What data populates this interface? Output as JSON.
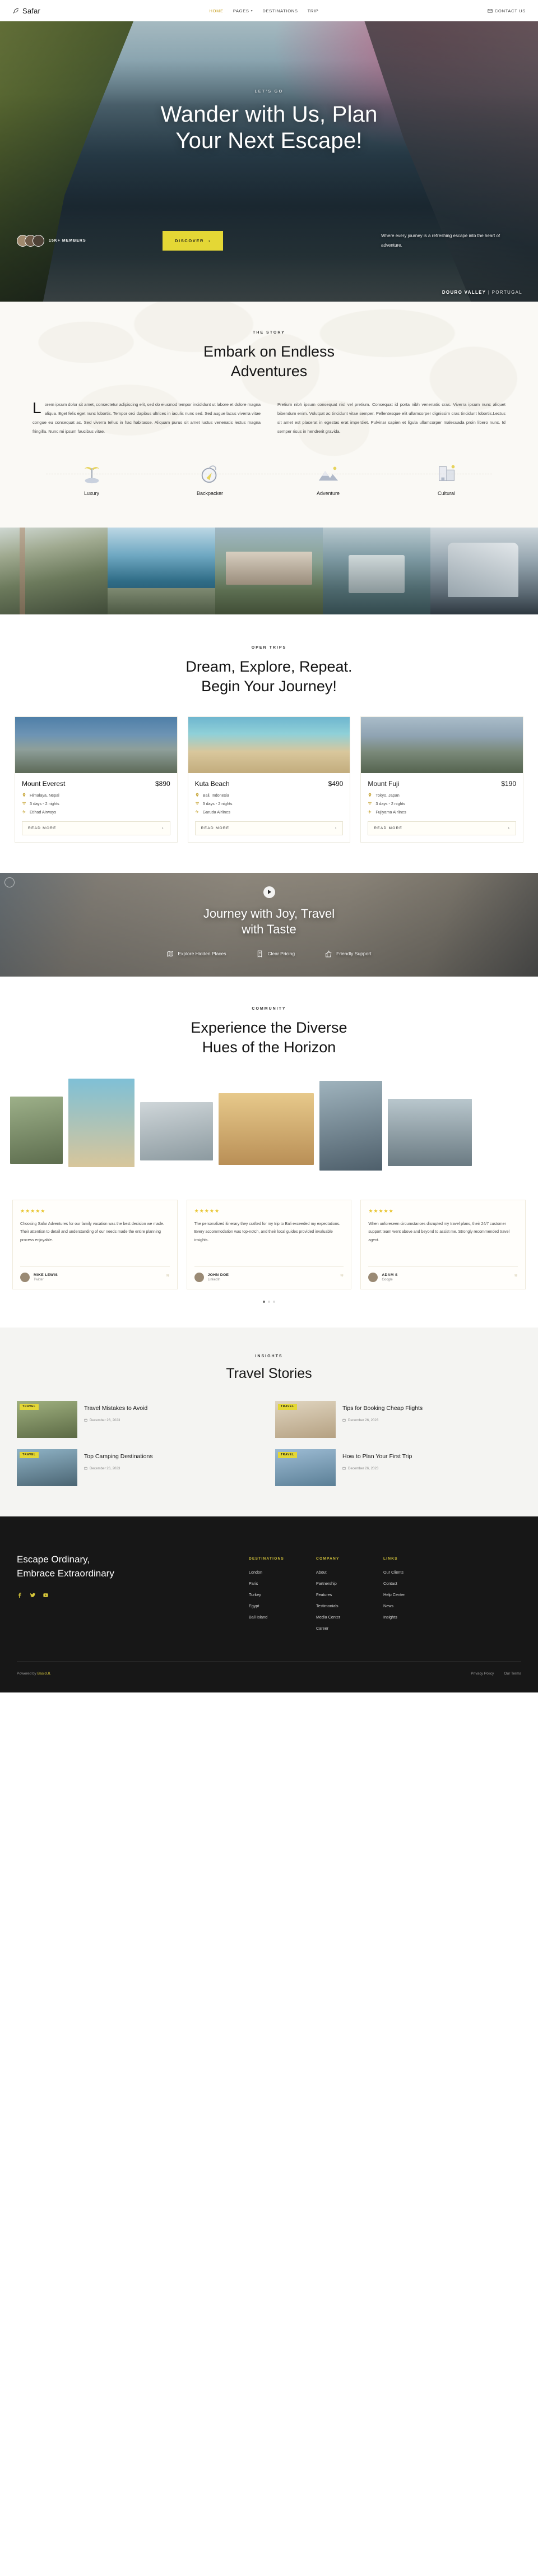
{
  "brand": {
    "name": "Safar",
    "logo_icon": "feather-icon"
  },
  "nav": {
    "links": [
      {
        "label": "HOME",
        "active": true
      },
      {
        "label": "PAGES",
        "has_dropdown": true
      },
      {
        "label": "DESTINATIONS"
      },
      {
        "label": "TRIP"
      }
    ],
    "contact": {
      "label": "CONTACT US",
      "icon": "mail-icon"
    }
  },
  "hero": {
    "eyebrow": "LET'S GO",
    "title_line1": "Wander with Us, Plan",
    "title_line2": "Your Next Escape!",
    "members_count": "15K+ MEMBERS",
    "cta": "DISCOVER",
    "subtitle": "Where every journey is a refreshing escape into the heart of adventure.",
    "location_primary": "DOURO VALLEY",
    "location_separator": "|",
    "location_secondary": "PORTUGAL"
  },
  "story": {
    "eyebrow": "THE STORY",
    "title_line1": "Embark on Endless",
    "title_line2": "Adventures",
    "paragraph_left": "Lorem ipsum dolor sit amet, consectetur adipiscing elit, sed do eiusmod tempor incididunt ut labore et dolore magna aliqua. Eget felis eget nunc lobortis. Tempor orci dapibus ultrices in iaculis nunc sed. Sed augue lacus viverra vitae congue eu consequat ac. Sed viverra tellus in hac habitasse. Aliquam purus sit amet luctus venenatis lectus magna fringilla. Nunc mi ipsum faucibus vitae.",
    "paragraph_right": "Pretium nibh ipsum consequat nisl vel pretium. Consequat id porta nibh venenatis cras. Viverra ipsum nunc aliquet bibendum enim. Volutpat ac tincidunt vitae semper. Pellentesque elit ullamcorper dignissim cras tincidunt lobortis.Lectus sit amet est placerat in egestas erat imperdiet. Pulvinar sapien et ligula ullamcorper malesuada proin libero nunc. Id semper risus in hendrerit gravida.",
    "categories": [
      {
        "label": "Luxury",
        "icon": "palm-tree-icon"
      },
      {
        "label": "Backpacker",
        "icon": "compass-icon"
      },
      {
        "label": "Adventure",
        "icon": "mountain-icon"
      },
      {
        "label": "Cultural",
        "icon": "landmark-icon"
      }
    ]
  },
  "gallery": {
    "items": [
      {
        "alt": "golden-gate-bridge-photo"
      },
      {
        "alt": "coastal-cliff-photo"
      },
      {
        "alt": "lakeside-village-photo"
      },
      {
        "alt": "modern-train-photo"
      },
      {
        "alt": "city-skyline-photo"
      }
    ]
  },
  "trips": {
    "eyebrow": "OPEN TRIPS",
    "title_line1": "Dream, Explore, Repeat.",
    "title_line2": "Begin Your Journey!",
    "cards": [
      {
        "name": "Mount Everest",
        "price": "$890",
        "location": "Himalaya, Nepal",
        "duration": "3 days - 2 nights",
        "airline": "Etihad Airways",
        "cta": "READ MORE"
      },
      {
        "name": "Kuta Beach",
        "price": "$490",
        "location": "Bali, Indonesia",
        "duration": "3 days - 2 nights",
        "airline": "Garuda Airlines",
        "cta": "READ MORE"
      },
      {
        "name": "Mount Fuji",
        "price": "$190",
        "location": "Tokyo, Japan",
        "duration": "3 days - 2 nights",
        "airline": "Fujiyama Airlines",
        "cta": "READ MORE"
      }
    ]
  },
  "video_cta": {
    "title_line1": "Journey with Joy, Travel",
    "title_line2": "with Taste",
    "features": [
      {
        "label": "Explore Hidden Places",
        "icon": "map-icon"
      },
      {
        "label": "Clear Pricing",
        "icon": "receipt-icon"
      },
      {
        "label": "Friendly Support",
        "icon": "thumbs-up-icon"
      }
    ]
  },
  "community": {
    "eyebrow": "COMMUNITY",
    "title_line1": "Experience the Diverse",
    "title_line2": "Hues of the Horizon",
    "testimonials": [
      {
        "rating": "★★★★★",
        "text": "Choosing Safar Adventures for our family vacation was the best decision we made. Their attention to detail and understanding of our needs made the entire planning process enjoyable.",
        "name": "MIKE LEWIS",
        "source": "Twitter"
      },
      {
        "rating": "★★★★★",
        "text": "The personalized itinerary they crafted for my trip to Bali exceeded my expectations. Every accommodation was top-notch, and their local guides provided invaluable insights.",
        "name": "JOHN DOE",
        "source": "LinkedIn"
      },
      {
        "rating": "★★★★★",
        "text": "When unforeseen circumstances disrupted my travel plans, their 24/7 customer support team went above and beyond to assist me. Strongly recommended travel agent.",
        "name": "ADAM S",
        "source": "Google"
      }
    ]
  },
  "insights": {
    "eyebrow": "INSIGHTS",
    "title": "Travel Stories",
    "posts": [
      {
        "tag": "TRAVEL",
        "title": "Travel Mistakes to Avoid",
        "date": "December 26, 2023"
      },
      {
        "tag": "TRAVEL",
        "title": "Tips for Booking Cheap Flights",
        "date": "December 26, 2023"
      },
      {
        "tag": "TRAVEL",
        "title": "Top Camping Destinations",
        "date": "December 26, 2023"
      },
      {
        "tag": "TRAVEL",
        "title": "How to Plan Your First Trip",
        "date": "December 26, 2023"
      }
    ]
  },
  "footer": {
    "headline_line1": "Escape Ordinary,",
    "headline_line2": "Embrace Extraordinary",
    "social": [
      {
        "name": "facebook-icon"
      },
      {
        "name": "twitter-icon"
      },
      {
        "name": "youtube-icon"
      }
    ],
    "columns": [
      {
        "heading": "DESTINATIONS",
        "items": [
          "London",
          "Paris",
          "Turkey",
          "Egypt",
          "Bali Island"
        ]
      },
      {
        "heading": "COMPANY",
        "items": [
          "About",
          "Partnership",
          "Features",
          "Testimonials",
          "Media Center",
          "Career"
        ]
      },
      {
        "heading": "LINKS",
        "items": [
          "Our Clients",
          "Contact",
          "Help Center",
          "News",
          "Insights"
        ]
      }
    ],
    "copyright_prefix": "Powered by ",
    "copyright_brand": "BasicUI.",
    "legal": [
      "Privacy Policy",
      "Our Terms"
    ]
  },
  "colors": {
    "accent_yellow": "#e4d735",
    "accent_gold": "#c9a227",
    "dark": "#171717",
    "star": "#e8c531"
  }
}
